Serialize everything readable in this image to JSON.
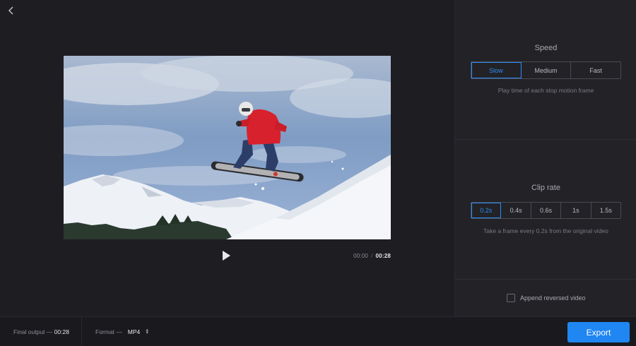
{
  "preview": {
    "back_icon": "chevron-left-icon",
    "play_icon": "play-icon",
    "time_current": "00:00",
    "time_separator": "/",
    "time_duration": "00:28"
  },
  "speed": {
    "title": "Speed",
    "options": [
      "Slow",
      "Medium",
      "Fast"
    ],
    "selected": "Slow",
    "hint": "Play time of each stop motion frame"
  },
  "clip_rate": {
    "title": "Clip rate",
    "options": [
      "0.2s",
      "0.4s",
      "0.6s",
      "1s",
      "1.5s"
    ],
    "selected": "0.2s",
    "hint": "Take a frame every 0.2s from the original video"
  },
  "append": {
    "label": "Append reversed video",
    "checked": false
  },
  "bottom": {
    "final_output_label": "Final output —",
    "final_output_value": "00:28",
    "format_label": "Format —",
    "format_value": "MP4",
    "export_label": "Export"
  },
  "colors": {
    "accent": "#1f86f2",
    "background": "#1d1d22",
    "panel": "#222227"
  }
}
